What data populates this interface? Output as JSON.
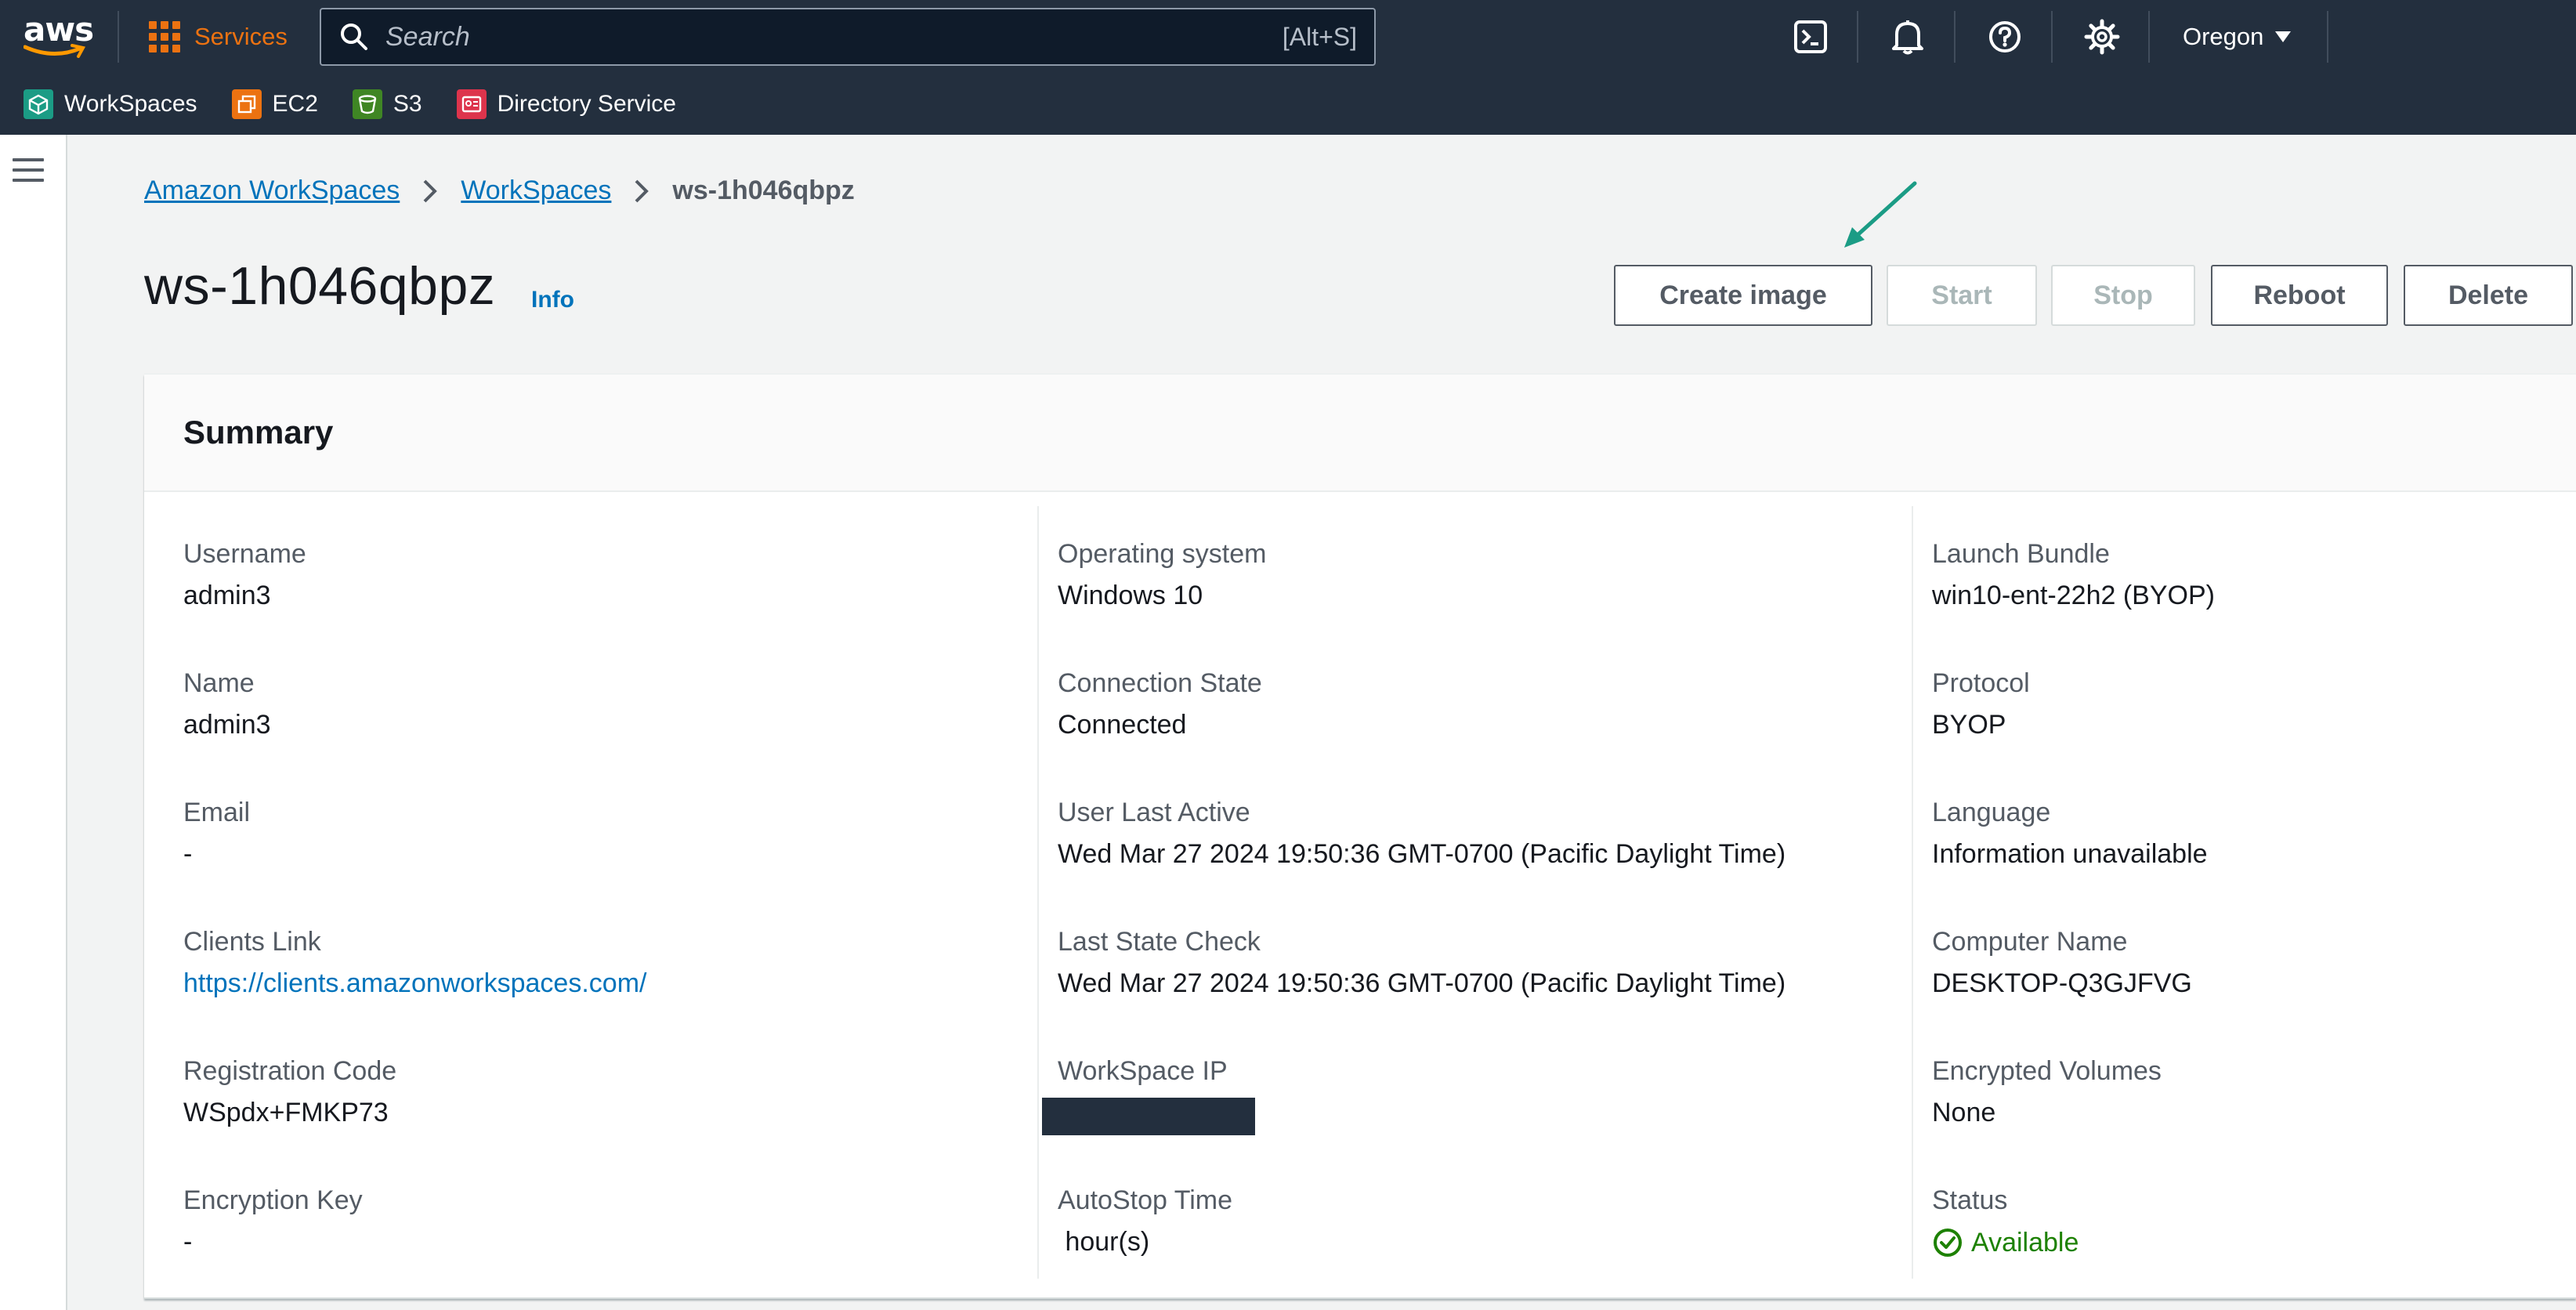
{
  "topnav": {
    "logo_text": "aws",
    "services_label": "Services",
    "search_placeholder": "Search",
    "search_shortcut": "[Alt+S]",
    "icons": [
      "cloudshell-icon",
      "notifications-bell-icon",
      "help-icon",
      "settings-gear-icon"
    ],
    "region": "Oregon"
  },
  "favorites": [
    {
      "label": "WorkSpaces",
      "icon": "workspaces-icon",
      "color": "#1b9c85"
    },
    {
      "label": "EC2",
      "icon": "ec2-icon",
      "color": "#ec7211"
    },
    {
      "label": "S3",
      "icon": "s3-icon",
      "color": "#3f8624"
    },
    {
      "label": "Directory Service",
      "icon": "directory-service-icon",
      "color": "#dd344c"
    }
  ],
  "breadcrumb": {
    "items": [
      "Amazon WorkSpaces",
      "WorkSpaces"
    ],
    "current": "ws-1h046qbpz"
  },
  "header": {
    "title": "ws-1h046qbpz",
    "info_label": "Info",
    "buttons": {
      "create_image": "Create image",
      "start": "Start",
      "stop": "Stop",
      "reboot": "Reboot",
      "delete": "Delete"
    }
  },
  "summary": {
    "title": "Summary",
    "col1": {
      "username_label": "Username",
      "username": "admin3",
      "name_label": "Name",
      "name": "admin3",
      "email_label": "Email",
      "email": "-",
      "clients_link_label": "Clients Link",
      "clients_link": "https://clients.amazonworkspaces.com/",
      "registration_code_label": "Registration Code",
      "registration_code": "WSpdx+FMKP73",
      "encryption_key_label": "Encryption Key",
      "encryption_key": "-"
    },
    "col2": {
      "os_label": "Operating system",
      "os": "Windows 10",
      "connection_state_label": "Connection State",
      "connection_state": "Connected",
      "user_last_active_label": "User Last Active",
      "user_last_active": "Wed Mar 27 2024 19:50:36 GMT-0700 (Pacific Daylight Time)",
      "last_state_check_label": "Last State Check",
      "last_state_check": "Wed Mar 27 2024 19:50:36 GMT-0700 (Pacific Daylight Time)",
      "workspace_ip_label": "WorkSpace IP",
      "autostop_label": "AutoStop Time",
      "autostop": " hour(s)"
    },
    "col3": {
      "launch_bundle_label": "Launch Bundle",
      "launch_bundle": "win10-ent-22h2 (BYOP)",
      "protocol_label": "Protocol",
      "protocol": "BYOP",
      "language_label": "Language",
      "language": "Information unavailable",
      "computer_name_label": "Computer Name",
      "computer_name": "DESKTOP-Q3GJFVG",
      "encrypted_volumes_label": "Encrypted Volumes",
      "encrypted_volumes": "None",
      "status_label": "Status",
      "status": "Available"
    }
  },
  "colors": {
    "nav_bg": "#232f3e",
    "accent_orange": "#ec7211",
    "link_blue": "#0073bb",
    "status_green": "#1d8102",
    "annotation_arrow": "#1b9c85"
  }
}
